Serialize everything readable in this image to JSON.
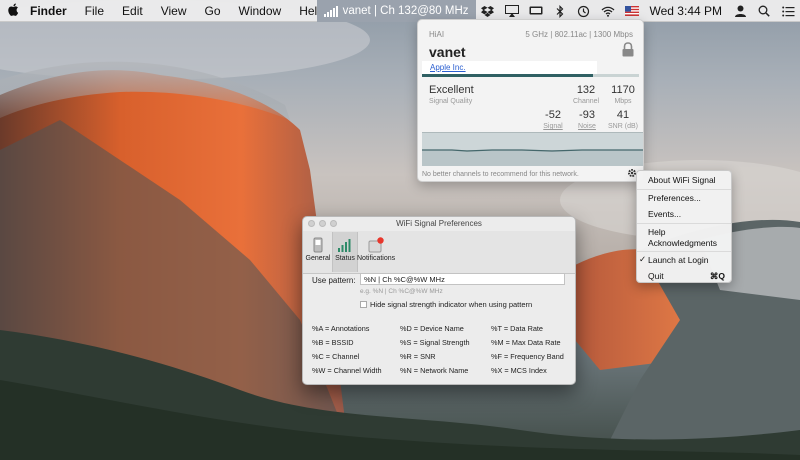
{
  "menubar": {
    "apple": "",
    "items": [
      "Finder",
      "File",
      "Edit",
      "View",
      "Go",
      "Window",
      "Help"
    ],
    "status_text": "vanet | Ch 132@80 MHz",
    "clock": "Wed 3:44 PM"
  },
  "popover": {
    "network_label": "HiAI",
    "spec": "5 GHz | 802.11ac | 1300 Mbps",
    "ssid": "vanet",
    "vendor": "Apple Inc.",
    "signal_fraction": 0.79,
    "quality": "Excellent",
    "quality_label": "Signal Quality",
    "channel": "132",
    "channel_label": "Channel",
    "rate": "1170",
    "rate_label": "Mbps",
    "signal": "-52",
    "signal_label": "Signal",
    "noise": "-93",
    "noise_label": "Noise",
    "snr": "41",
    "snr_label": "SNR (dB)",
    "footer": "No better channels to recommend for this network."
  },
  "context_menu": {
    "items": [
      "About WiFi Signal",
      "Preferences...",
      "Events...",
      "Help",
      "Acknowledgments",
      "Launch at Login",
      "Quit"
    ],
    "quit_shortcut": "⌘Q"
  },
  "prefs": {
    "title": "WiFi Signal Preferences",
    "tabs": [
      "General",
      "Status",
      "Notifications"
    ],
    "pattern_label": "Use pattern:",
    "pattern_value": "%N | Ch %C@%W MHz",
    "pattern_hint": "e.g. %N | Ch %C@%W MHz",
    "checkbox_label": "Hide signal strength indicator when using pattern",
    "legend_col1": [
      "%A = Annotations",
      "%B = BSSID",
      "%C = Channel",
      "%W = Channel Width"
    ],
    "legend_col2": [
      "%D = Device Name",
      "%S = Signal Strength",
      "%R = SNR",
      "%N = Network Name"
    ],
    "legend_col3": [
      "%T = Data Rate",
      "%M = Max Data Rate",
      "%F = Frequency Band",
      "%X = MCS Index"
    ]
  }
}
